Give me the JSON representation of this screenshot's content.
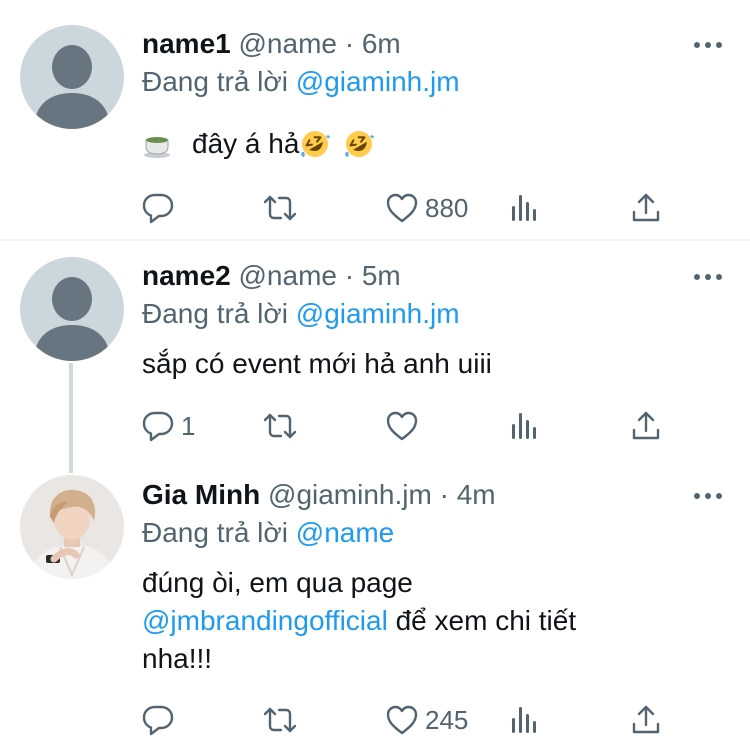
{
  "reply_prefix": "Đang trả lời",
  "colors": {
    "text": "#0f1419",
    "muted": "#536471",
    "link": "#1d9bf0",
    "avatar_default": "#ccd6dd",
    "thread_line": "#cfd9de"
  },
  "tweets": [
    {
      "name": "name1",
      "handle": "@name",
      "dot": "·",
      "time": "6m",
      "reply_to": "@giaminh.jm",
      "text": "đây á hả",
      "emoji_icons": [
        "teacup-icon",
        "rofl-emoji-icon",
        "rofl-emoji-icon"
      ],
      "reply_count": "",
      "like_count": "880"
    },
    {
      "name": "name2",
      "handle": "@name",
      "dot": "·",
      "time": "5m",
      "reply_to": "@giaminh.jm",
      "text": "sắp có event mới hả anh uiii",
      "reply_count": "1",
      "like_count": ""
    },
    {
      "name": "Gia Minh",
      "handle": "@giaminh.jm",
      "dot": "·",
      "time": "4m",
      "reply_to": "@name",
      "text_line1": "đúng òi, em qua page",
      "text_mention": "@jmbrandingofficial",
      "text_after_mention": " để xem chi tiết",
      "text_line3": "nha!!!",
      "reply_count": "",
      "like_count": "245"
    }
  ]
}
